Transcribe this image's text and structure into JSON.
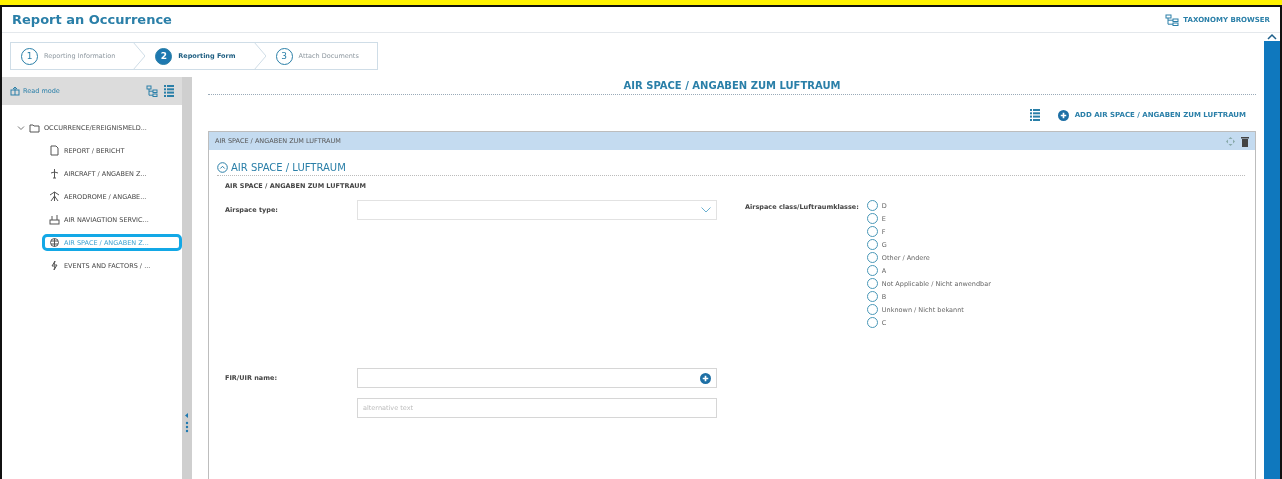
{
  "header": {
    "title": "Report an Occurrence",
    "taxonomy_link": "TAXONOMY BROWSER"
  },
  "steps": [
    {
      "number": "1",
      "label": "Reporting Information",
      "selected": false
    },
    {
      "number": "2",
      "label": "Reporting Form",
      "selected": true
    },
    {
      "number": "3",
      "label": "Attach Documents",
      "selected": false
    }
  ],
  "sidebar": {
    "read_mode": "Read mode",
    "tree": [
      {
        "label": "OCCURRENCE/EREIGNISMELD...",
        "expanded": true,
        "selected": false,
        "children": [
          {
            "label": "REPORT / BERICHT",
            "kind": "document",
            "selected": false
          },
          {
            "label": "AIRCRAFT / ANGABEN Z...",
            "kind": "aircraft",
            "selected": false
          },
          {
            "label": "AERODROME / ANGABE...",
            "kind": "aerodrome",
            "selected": false
          },
          {
            "label": "AIR NAVIAGTION SERVIC...",
            "kind": "navigation",
            "selected": false
          },
          {
            "label": "AIR SPACE / ANGABEN Z...",
            "kind": "airspace",
            "selected": true
          },
          {
            "label": "EVENTS AND FACTORS / ...",
            "kind": "events",
            "selected": false
          }
        ]
      }
    ]
  },
  "main": {
    "title": "AIR SPACE / ANGABEN ZUM LUFTRAUM",
    "add_button": "ADD AIR SPACE / ANGABEN ZUM LUFTRAUM",
    "panel": {
      "title": "AIR SPACE / ANGABEN ZUM LUFTRAUM",
      "section_title": "AIR SPACE / LUFTRAUM",
      "expanded": true,
      "subsection": "AIR SPACE / ANGABEN ZUM LUFTRAUM",
      "airspace_type": {
        "label": "Airspace type:"
      },
      "airspace_class": {
        "label": "Airspace class/Luftraumklasse:",
        "options": [
          {
            "label": "D",
            "selected": false
          },
          {
            "label": "E",
            "selected": false
          },
          {
            "label": "F",
            "selected": false
          },
          {
            "label": "G",
            "selected": false
          },
          {
            "label": "Other / Andere",
            "selected": false
          },
          {
            "label": "A",
            "selected": false
          },
          {
            "label": "Not Applicable / Nicht anwendbar",
            "selected": false
          },
          {
            "label": "B",
            "selected": false
          },
          {
            "label": "Unknown / Nicht bekannt",
            "selected": false
          },
          {
            "label": "C",
            "selected": false
          }
        ]
      },
      "fir_name": {
        "label": "FIR/UIR name:",
        "placeholder": "alternative text"
      }
    }
  }
}
